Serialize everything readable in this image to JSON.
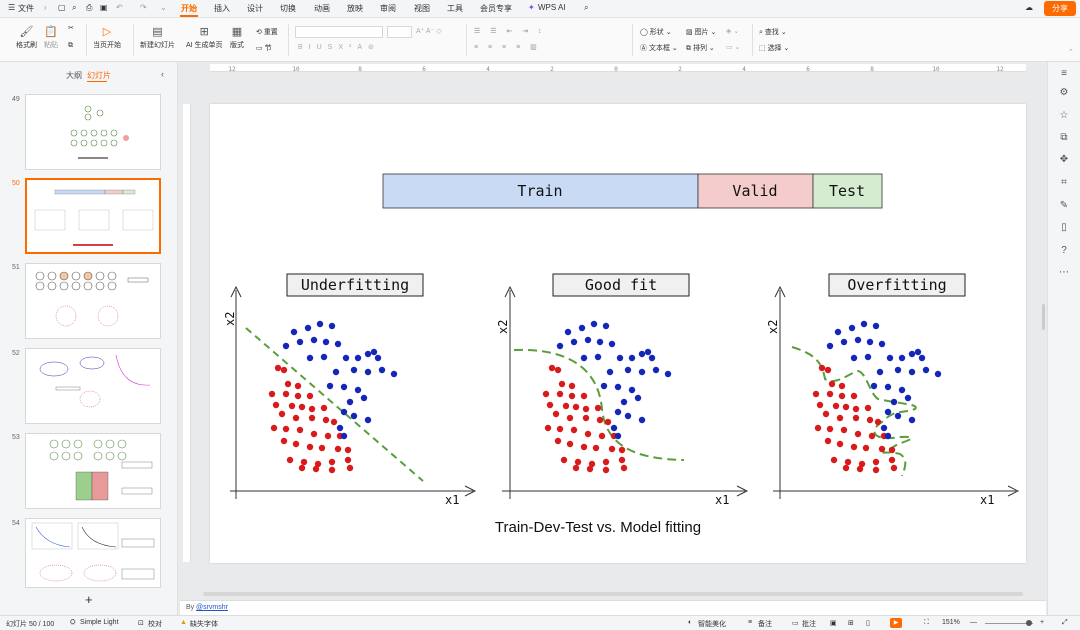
{
  "titlebar": {
    "file_label": "文件",
    "tabs": [
      "开始",
      "插入",
      "设计",
      "切换",
      "动画",
      "放映",
      "审阅",
      "视图",
      "工具",
      "会员专享"
    ],
    "active_tab": "开始",
    "wps_ai": "WPS AI",
    "share": "分享"
  },
  "ribbon": {
    "format_painter": "格式刷",
    "paste": "粘贴",
    "play_from_current": "当页开始",
    "new_slide": "新建幻灯片",
    "ai_generate": "AI 生成单页",
    "layout": "版式",
    "reset": "重置",
    "section": "节",
    "shape": "形状",
    "picture": "图片",
    "textbox": "文本框",
    "arrange": "排列",
    "find": "查找",
    "select": "选择"
  },
  "leftpanel": {
    "tab_outline": "大纲",
    "tab_slides": "幻灯片",
    "slide_numbers": [
      "49",
      "50",
      "51",
      "52",
      "53",
      "54"
    ],
    "active_slide": "50",
    "add_label": "+"
  },
  "ruler": {
    "h_ticks": [
      "12",
      "10",
      "8",
      "6",
      "4",
      "2",
      "0",
      "2",
      "4",
      "6",
      "8",
      "10",
      "12"
    ]
  },
  "slide": {
    "split_bar": {
      "train": "Train",
      "valid": "Valid",
      "test": "Test"
    },
    "panels": [
      {
        "title": "Underfitting",
        "xlabel": "x1",
        "ylabel": "x2"
      },
      {
        "title": "Good fit",
        "xlabel": "x1",
        "ylabel": "x2"
      },
      {
        "title": "Overfitting",
        "xlabel": "x1",
        "ylabel": "x2"
      }
    ],
    "caption": "Train-Dev-Test vs. Model fitting",
    "colors": {
      "red": "#d91a1a",
      "blue": "#1426b8",
      "boundary": "#5a9e3a",
      "train_fill": "#c9daf5",
      "valid_fill": "#f5cccc",
      "test_fill": "#d6ecd0"
    }
  },
  "notes": {
    "by": "By",
    "author": "@srvmshr"
  },
  "status": {
    "slide_counter": "幻灯片 50 / 100",
    "theme": "Simple Light",
    "proofing": "校对",
    "missing_font": "缺失字体",
    "smart_beautify": "智能美化",
    "notes_btn": "备注",
    "comments_btn": "批注",
    "zoom": "151%"
  }
}
